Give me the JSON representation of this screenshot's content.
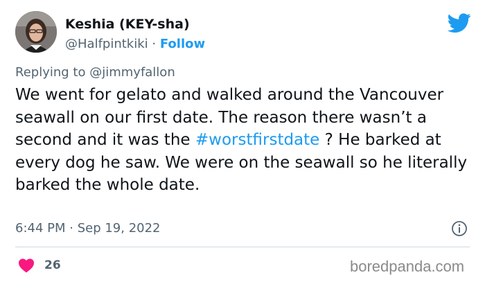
{
  "author": {
    "name": "Keshia (KEY-sha)",
    "handle": "@Halfpintkiki",
    "separator": "·",
    "follow_label": "Follow"
  },
  "reply": {
    "prefix": "Replying to",
    "mention": "@jimmyfallon"
  },
  "tweet": {
    "text_part1": "We went for gelato and walked around the Vancouver seawall on our first date. The reason there wasn’t a second and it was the ",
    "hashtag": "#worstfirstdate",
    "text_part2": " ? He barked at every dog he saw. We were on the seawall so he literally barked the whole date.",
    "timestamp": "6:44 PM · Sep 19, 2022"
  },
  "engagement": {
    "like_count": "26"
  },
  "watermark": "boredpanda.com",
  "colors": {
    "accent": "#1d9bf0",
    "heart": "#f91880",
    "secondary_text": "#536471"
  },
  "icons": {
    "brand": "twitter-bird-icon",
    "info": "info-icon",
    "like": "heart-icon"
  }
}
